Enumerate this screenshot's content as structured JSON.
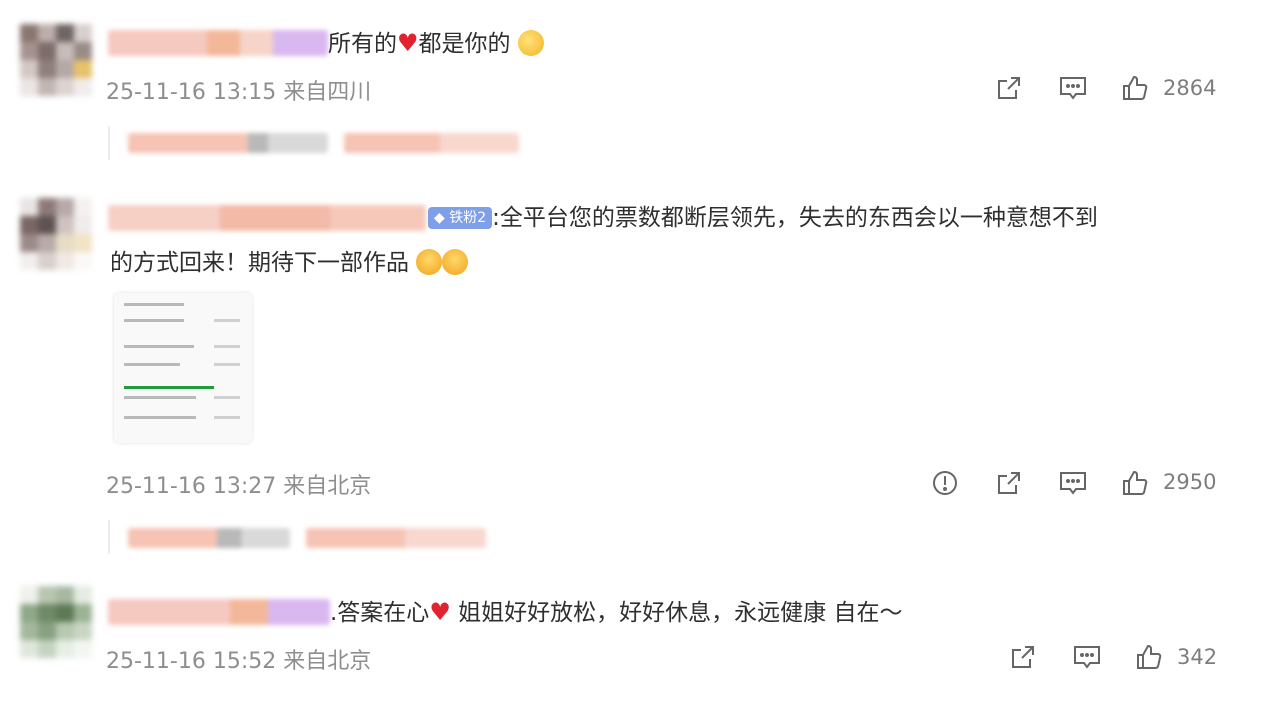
{
  "comments": [
    {
      "text_tail": "所有的",
      "text_after_heart": "都是你的",
      "timestamp": "25-11-16 13:15",
      "location": "来自四川",
      "likes": "2864",
      "emoji_icon": "kiss-face-icon"
    },
    {
      "badge": "铁粉2",
      "line1": ":全平台您的票数都断层领先，失去的东西会以一种意想不到",
      "line2": "的方式回来！期待下一部作品",
      "timestamp": "25-11-16 13:27",
      "location": "来自北京",
      "likes": "2950",
      "emoji_icon": "crying-face-icon"
    },
    {
      "text_pre": ".答案在心",
      "text_post": " 姐姐好好放松，好好休息，永远健康 自在～",
      "timestamp": "25-11-16 15:52",
      "location": "来自北京",
      "likes": "342"
    }
  ],
  "icons": {
    "share": "share-icon",
    "comment": "comment-icon",
    "like": "thumbs-up-icon",
    "report": "report-icon",
    "heart": "heart-icon"
  },
  "colors": {
    "heart": "#e2232f",
    "meta_text": "#8e8e8e",
    "badge": "#7fa0e8"
  }
}
